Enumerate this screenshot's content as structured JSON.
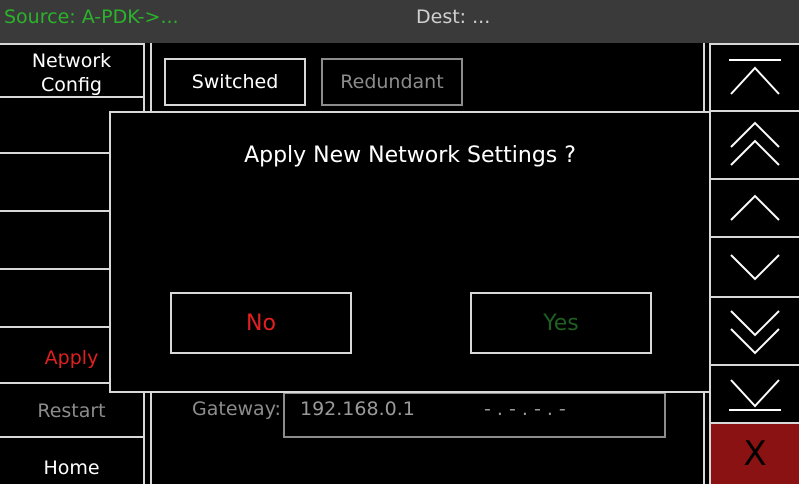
{
  "header": {
    "source": "Source: A-PDK->...",
    "dest": "Dest:  ..."
  },
  "left_menu": {
    "network_config": "Network\nConfig",
    "apply": "Apply",
    "restart": "Restart",
    "home": "Home"
  },
  "tabs": {
    "switched": "Switched",
    "redundant": "Redundant"
  },
  "gateway": {
    "label": "Gateway:",
    "value": "192.168.0.1",
    "value2": "- . - . - . -"
  },
  "dialog": {
    "title": "Apply New Network Settings ?",
    "no": "No",
    "yes": "Yes"
  },
  "right_nav": {
    "buttons": [
      "scroll-top-icon",
      "page-up-icon",
      "up-icon",
      "down-icon",
      "page-down-icon",
      "scroll-bottom-icon"
    ],
    "close": "X"
  },
  "colors": {
    "source": "#2bb32b",
    "apply": "#e02020",
    "no": "#e02020",
    "yes": "#1f5f1f",
    "close_bg": "#8a1212",
    "disabled": "#8c8c8c"
  }
}
